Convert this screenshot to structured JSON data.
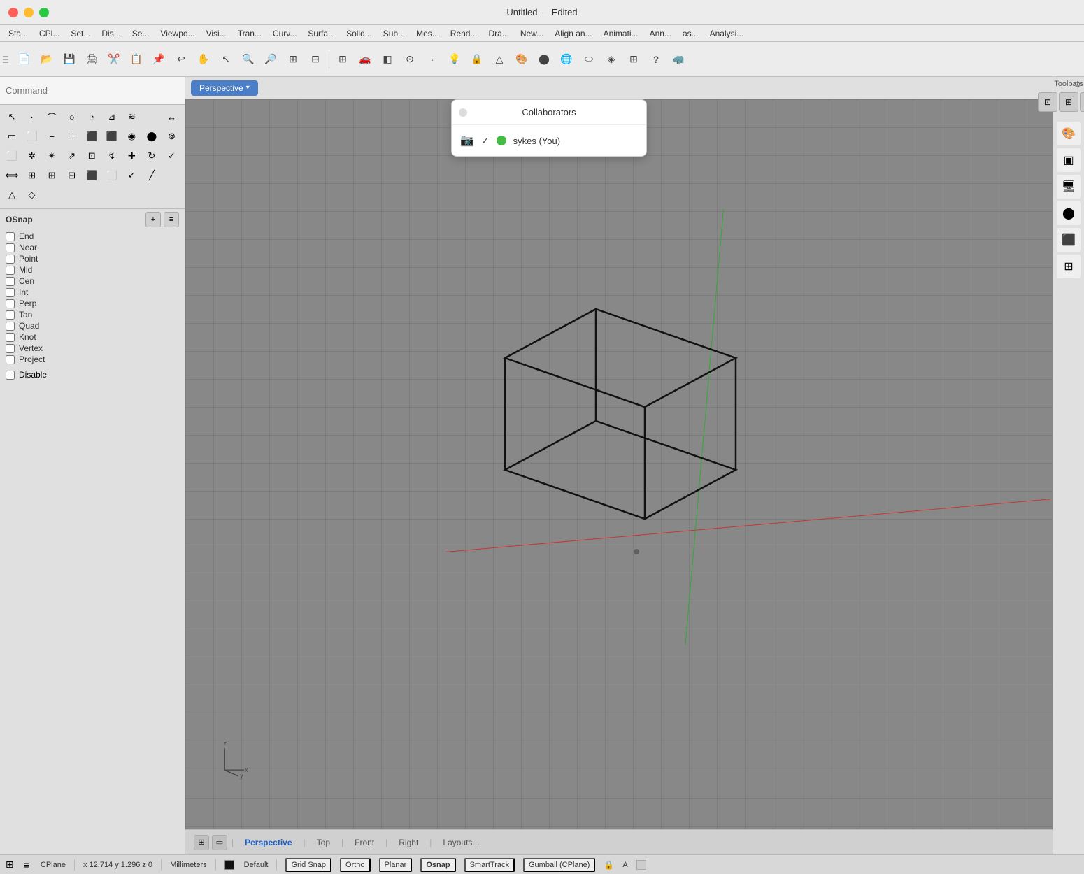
{
  "titlebar": {
    "title": "Untitled — Edited"
  },
  "menubar": {
    "items": [
      "Sta...",
      "CPl...",
      "Set...",
      "Dis...",
      "Se...",
      "Viewpo...",
      "Visi...",
      "Tran...",
      "Curv...",
      "Surfa...",
      "Solid...",
      "Sub...",
      "Mes...",
      "Rend...",
      "Dra...",
      "New...",
      "Align an...",
      "Animati...",
      "Ann...",
      "as...",
      "Analysi..."
    ]
  },
  "command": {
    "placeholder": "Command",
    "label": "Command"
  },
  "viewport": {
    "label": "Perspective",
    "dropdown_arrow": "▾"
  },
  "collaborators": {
    "title": "Collaborators",
    "user": "sykes (You)"
  },
  "osnap": {
    "title": "OSnap",
    "items": [
      "End",
      "Near",
      "Point",
      "Mid",
      "Cen",
      "Int",
      "Perp",
      "Tan",
      "Quad",
      "Knot",
      "Vertex",
      "Project"
    ],
    "disable_label": "Disable"
  },
  "viewport_tabs": {
    "items": [
      "Perspective",
      "Top",
      "Front",
      "Right",
      "Layouts..."
    ],
    "active": "Perspective"
  },
  "statusbar": {
    "cplane": "CPlane",
    "coords": "x 12.714  y 1.296  z 0",
    "units": "Millimeters",
    "layer_default": "Default",
    "grid_snap": "Grid Snap",
    "ortho": "Ortho",
    "planar": "Planar",
    "osnap": "Osnap",
    "smarttrack": "SmartTrack",
    "gumball": "Gumball (CPlane)",
    "a_label": "A"
  },
  "toolbars_right": {
    "title": "Toolbars"
  },
  "icons": {
    "close": "✕",
    "gear": "⚙",
    "add": "+",
    "filter": "⊟",
    "check": "✓",
    "lock": "🔒"
  }
}
